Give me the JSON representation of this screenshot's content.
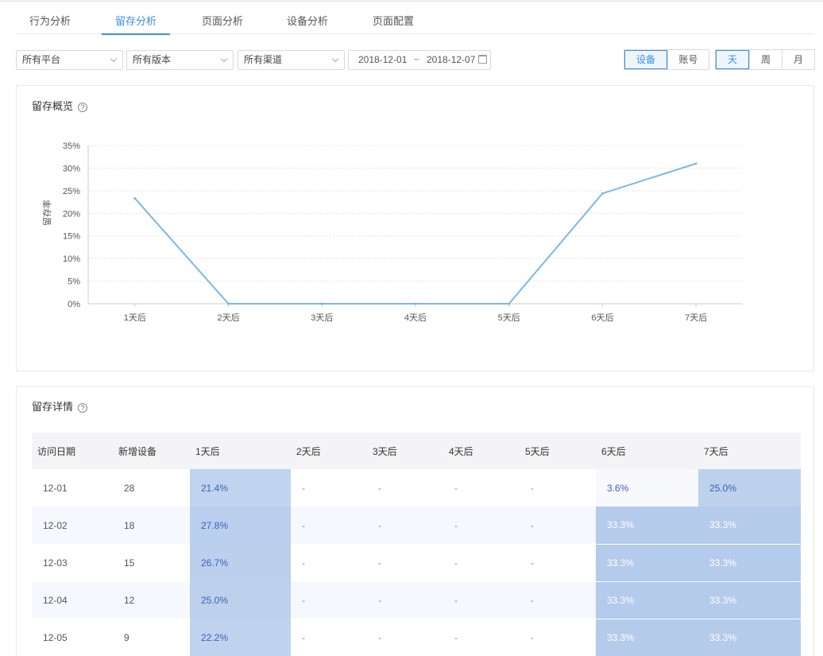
{
  "tabs": [
    {
      "label": "行为分析",
      "active": false
    },
    {
      "label": "留存分析",
      "active": true
    },
    {
      "label": "页面分析",
      "active": false
    },
    {
      "label": "设备分析",
      "active": false
    },
    {
      "label": "页面配置",
      "active": false
    }
  ],
  "filters": {
    "platform": "所有平台",
    "version": "所有版本",
    "channel": "所有渠道",
    "date_start": "2018-12-01",
    "date_sep": "~",
    "date_end": "2018-12-07"
  },
  "subject_toggle": {
    "options": [
      "设备",
      "账号"
    ],
    "active": "设备"
  },
  "period_toggle": {
    "options": [
      "天",
      "周",
      "月"
    ],
    "active": "天"
  },
  "overview": {
    "title": "留存概览",
    "help": "?"
  },
  "chart_data": {
    "type": "line",
    "categories": [
      "1天后",
      "2天后",
      "3天后",
      "4天后",
      "5天后",
      "6天后",
      "7天后"
    ],
    "series": [
      {
        "values": [
          23.3,
          0,
          0,
          0,
          0,
          24.4,
          31.0
        ]
      }
    ],
    "ylabel": "留存率",
    "ylim": [
      0,
      35
    ],
    "yticks": [
      0,
      5,
      10,
      15,
      20,
      25,
      30,
      35
    ],
    "ytick_labels": [
      "0%",
      "5%",
      "10%",
      "15%",
      "20%",
      "25%",
      "30%",
      "35%"
    ],
    "grid": true,
    "color": "#7ab8e8"
  },
  "details": {
    "title": "留存详情",
    "help": "?",
    "columns": [
      "访问日期",
      "新增设备",
      "1天后",
      "2天后",
      "3天后",
      "4天后",
      "5天后",
      "6天后",
      "7天后"
    ],
    "rows": [
      {
        "date": "12-01",
        "count": "28",
        "cells": [
          "21.4%",
          "-",
          "-",
          "-",
          "-",
          "3.6%",
          "25.0%"
        ],
        "levels": [
          21.4,
          null,
          null,
          null,
          null,
          3.6,
          25.0
        ]
      },
      {
        "date": "12-02",
        "count": "18",
        "cells": [
          "27.8%",
          "-",
          "-",
          "-",
          "-",
          "33.3%",
          "33.3%"
        ],
        "levels": [
          27.8,
          null,
          null,
          null,
          null,
          33.3,
          33.3
        ]
      },
      {
        "date": "12-03",
        "count": "15",
        "cells": [
          "26.7%",
          "-",
          "-",
          "-",
          "-",
          "33.3%",
          "33.3%"
        ],
        "levels": [
          26.7,
          null,
          null,
          null,
          null,
          33.3,
          33.3
        ]
      },
      {
        "date": "12-04",
        "count": "12",
        "cells": [
          "25.0%",
          "-",
          "-",
          "-",
          "-",
          "33.3%",
          "33.3%"
        ],
        "levels": [
          25.0,
          null,
          null,
          null,
          null,
          33.3,
          33.3
        ]
      },
      {
        "date": "12-05",
        "count": "9",
        "cells": [
          "22.2%",
          "-",
          "-",
          "-",
          "-",
          "33.3%",
          "33.3%"
        ],
        "levels": [
          22.2,
          null,
          null,
          null,
          null,
          33.3,
          33.3
        ]
      }
    ]
  }
}
